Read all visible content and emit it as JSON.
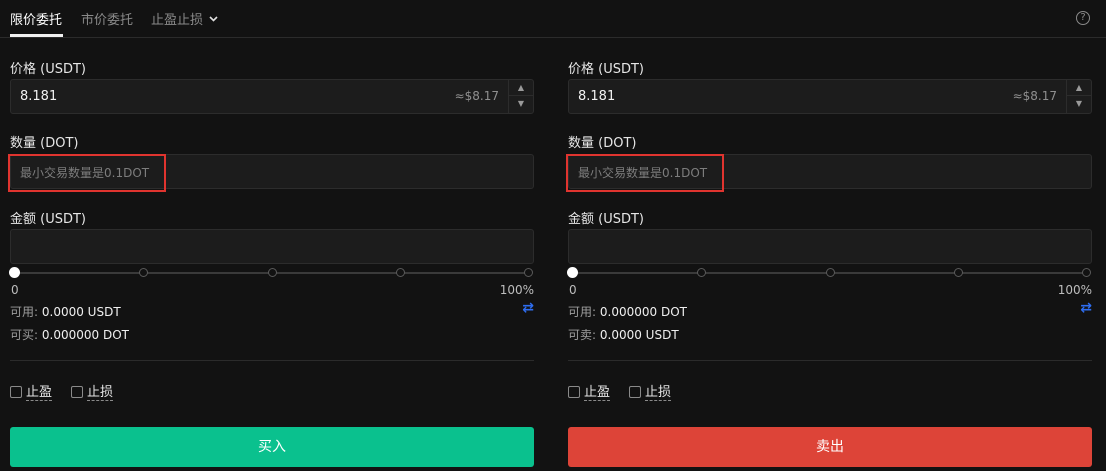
{
  "tabs": {
    "limit": "限价委托",
    "market": "市价委托",
    "stop": "止盈止损"
  },
  "help_icon": "?",
  "buy_panel": {
    "price_label": "价格 (USDT)",
    "price_value": "8.181",
    "price_approx": "≈$8.17",
    "qty_label": "数量 (DOT)",
    "qty_placeholder": "最小交易数量是0.1DOT",
    "amount_label": "金额 (USDT)",
    "amount_value": "",
    "slider_min": "0%",
    "slider_max": "100%",
    "slider_value_pct": 0,
    "available_label": "可用:",
    "available_value": "0.0000 USDT",
    "can_trade_label": "可买:",
    "can_trade_value": "0.000000 DOT",
    "take_profit": "止盈",
    "stop_loss": "止损",
    "action": "买入",
    "action_color": "#0ac18e"
  },
  "sell_panel": {
    "price_label": "价格 (USDT)",
    "price_value": "8.181",
    "price_approx": "≈$8.17",
    "qty_label": "数量 (DOT)",
    "qty_placeholder": "最小交易数量是0.1DOT",
    "amount_label": "金额 (USDT)",
    "amount_value": "",
    "slider_min": "0",
    "slider_max": "100%",
    "slider_value_pct": 0,
    "available_label": "可用:",
    "available_value": "0.000000 DOT",
    "can_trade_label": "可卖:",
    "can_trade_value": "0.0000 USDT",
    "take_profit": "止盈",
    "stop_loss": "止损",
    "action": "卖出",
    "action_color": "#dd4438"
  },
  "icons": {
    "dropdown": "chevron-down-icon",
    "swap": "swap-arrows-icon",
    "stepper_up": "triangle-up-icon",
    "stepper_down": "triangle-down-icon",
    "help": "question-circle-icon"
  }
}
